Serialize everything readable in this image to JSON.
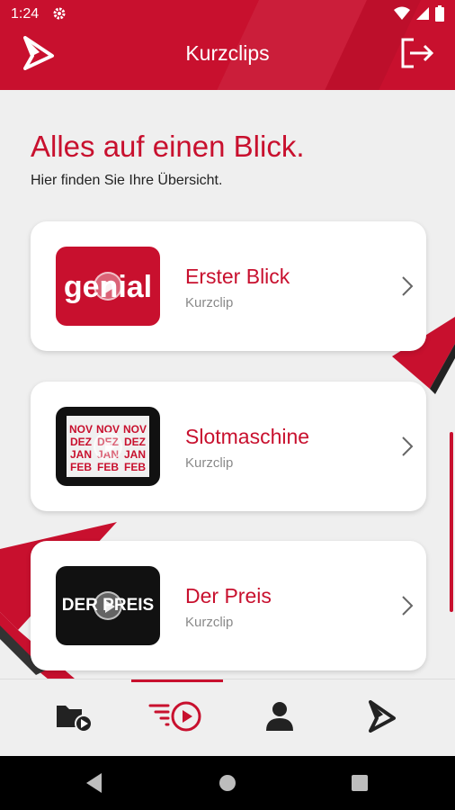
{
  "status_bar": {
    "time": "1:24",
    "icons": [
      "gear-icon",
      "wifi-icon",
      "signal-icon",
      "battery-icon"
    ]
  },
  "appbar": {
    "title": "Kurzclips",
    "left_icon": "app-logo-icon",
    "right_icon": "logout-icon"
  },
  "page": {
    "heading": "Alles auf einen Blick.",
    "subheading": "Hier finden Sie Ihre Übersicht."
  },
  "cards": [
    {
      "title": "Erster Blick",
      "subtitle": "Kurzclip",
      "thumb_text": "genial"
    },
    {
      "title": "Slotmaschine",
      "subtitle": "Kurzclip",
      "thumb_reels": [
        [
          "NOV",
          "DEZ",
          "JAN",
          "FEB"
        ],
        [
          "NOV",
          "DEZ",
          "JAN",
          "FEB"
        ],
        [
          "NOV",
          "DEZ",
          "JAN",
          "FEB"
        ]
      ]
    },
    {
      "title": "Der Preis",
      "subtitle": "Kurzclip",
      "thumb_text": "DER PREIS"
    }
  ],
  "bottom_nav": {
    "items": [
      {
        "icon": "folder-play-icon"
      },
      {
        "icon": "fast-play-icon",
        "active": true
      },
      {
        "icon": "person-icon"
      },
      {
        "icon": "app-logo-icon"
      }
    ]
  },
  "colors": {
    "brand": "#c8102e",
    "background": "#efefef",
    "card": "#ffffff",
    "muted": "#8a8a8a"
  }
}
